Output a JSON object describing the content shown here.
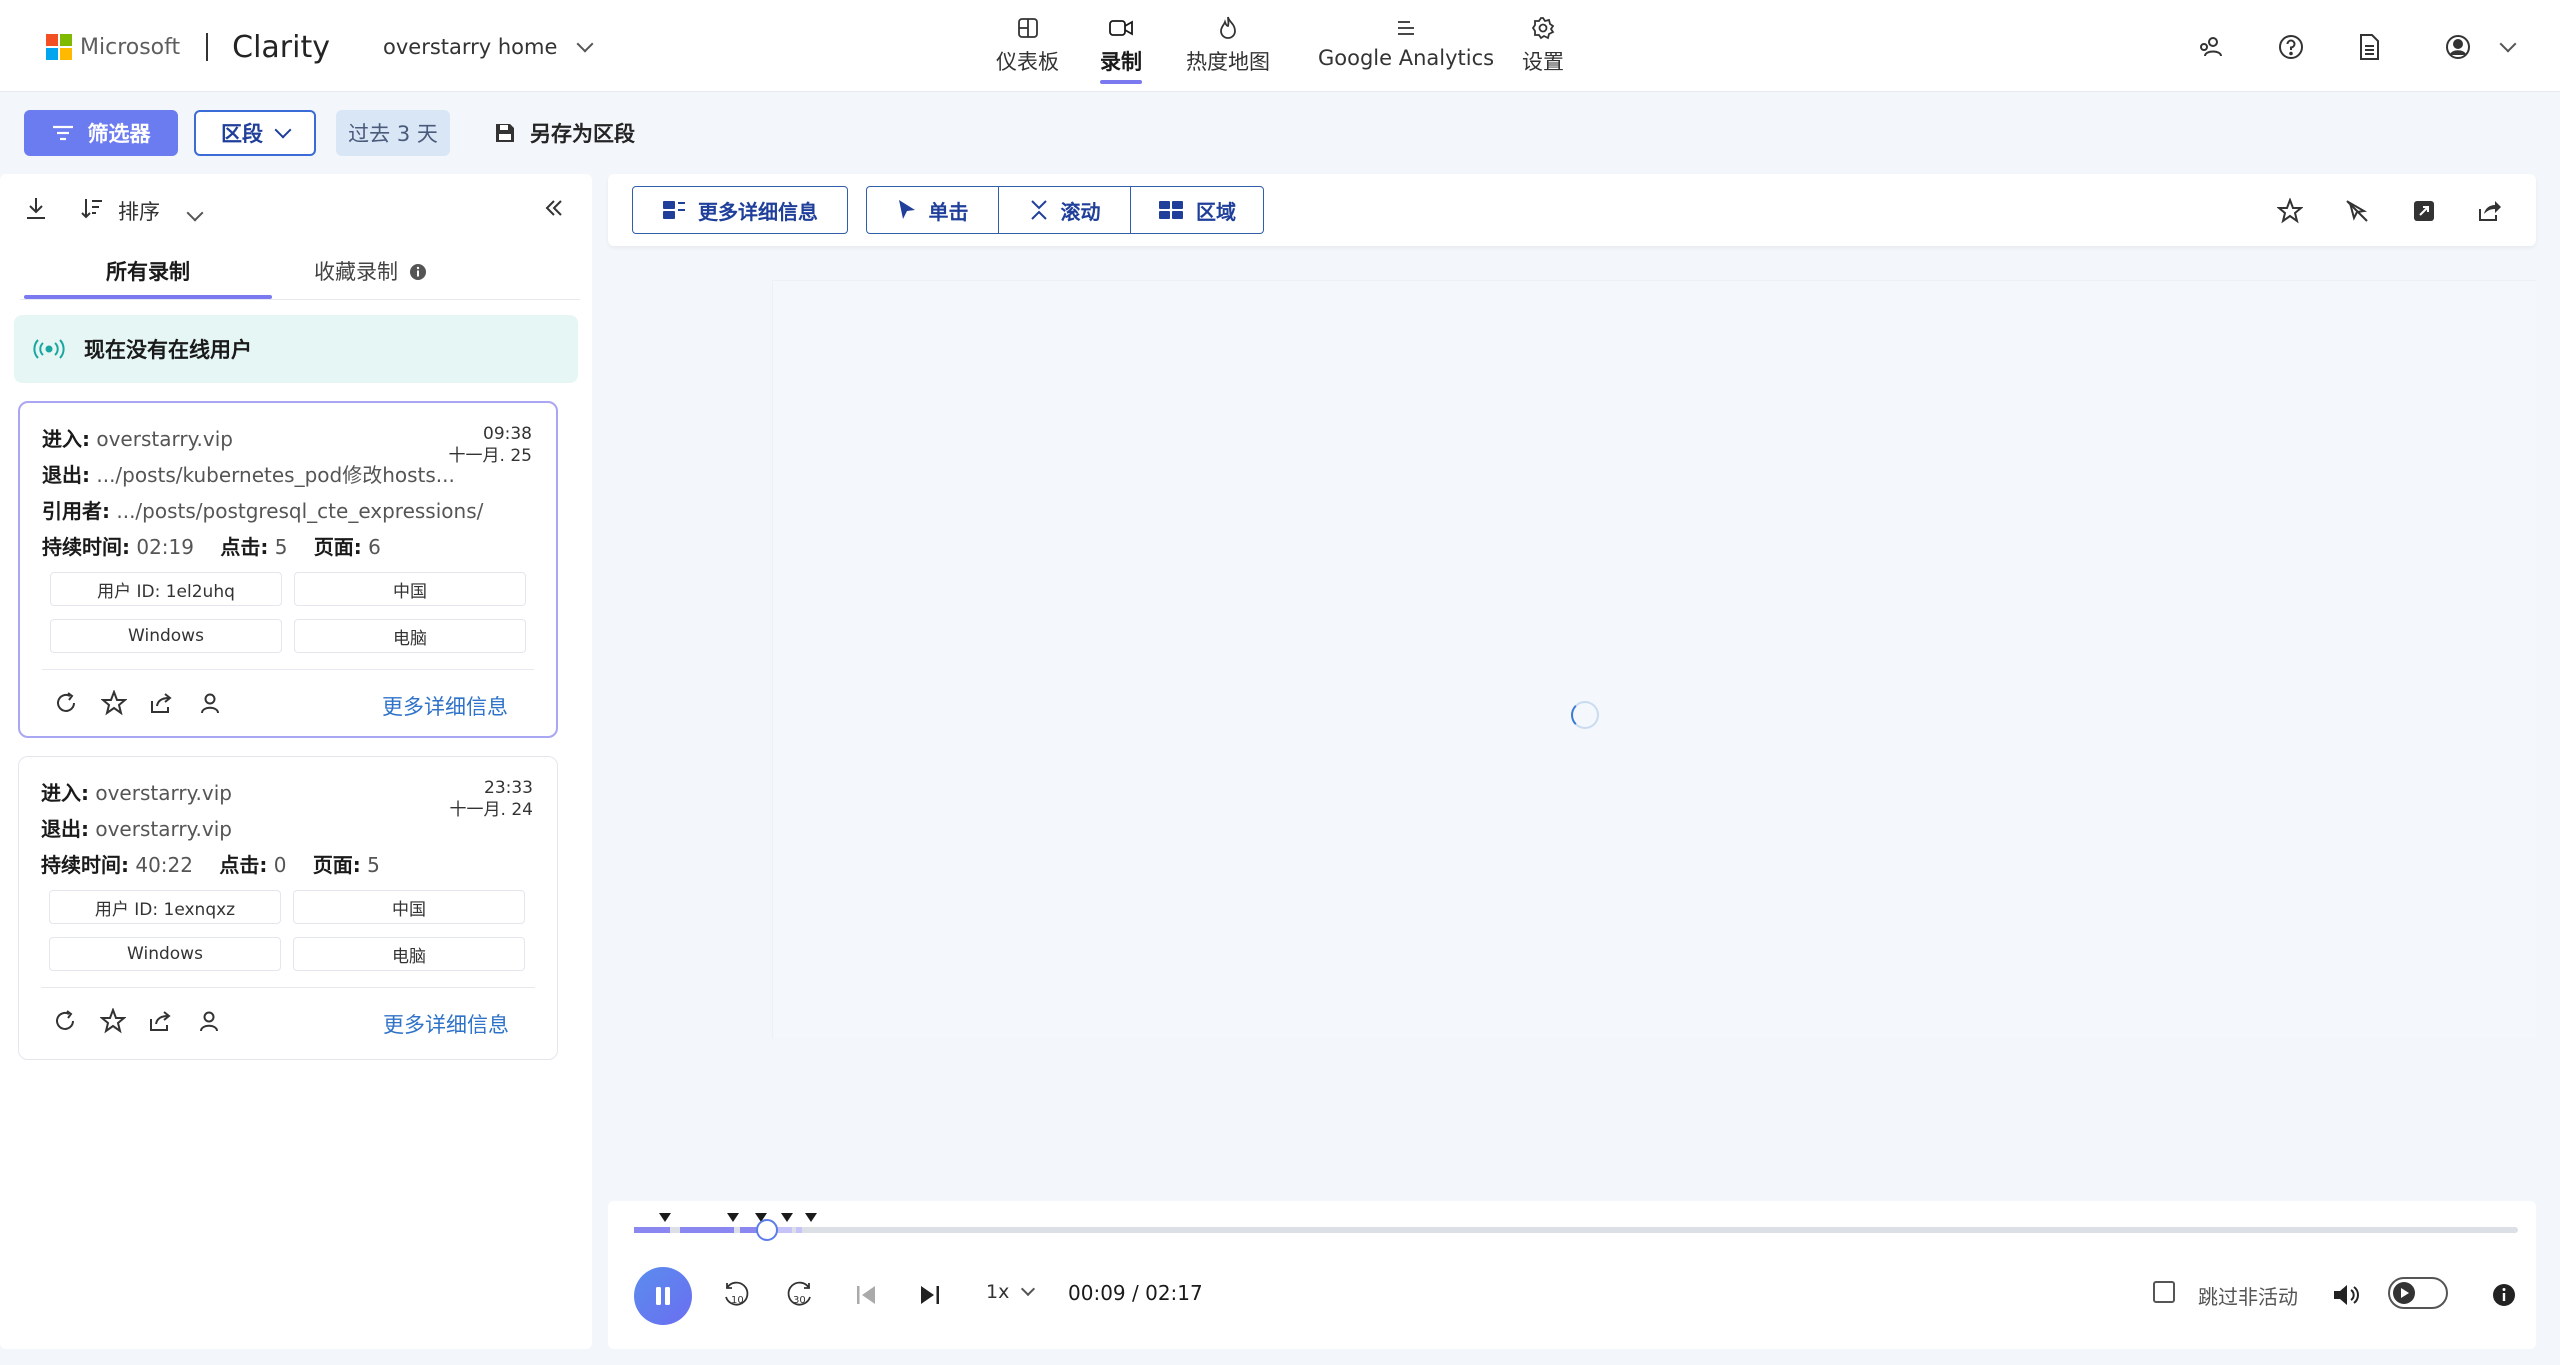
{
  "header": {
    "ms_name": "Microsoft",
    "app_name": "Clarity",
    "project": "overstarry home",
    "nav": [
      {
        "label": "仪表板"
      },
      {
        "label": "录制"
      },
      {
        "label": "热度地图"
      },
      {
        "label": "Google Analytics"
      },
      {
        "label": "设置"
      }
    ],
    "active_nav": "录制",
    "accent_color": "#7b79ef"
  },
  "toolbar": {
    "filter_label": "筛选器",
    "segment_label": "区段",
    "date_label": "过去 3 天",
    "save_segment_label": "另存为区段"
  },
  "sidebar": {
    "sort_label": "排序",
    "tabs": [
      {
        "label": "所有录制"
      },
      {
        "label": "收藏录制"
      }
    ],
    "live_text": "现在没有在线用户",
    "more_link": "更多详细信息",
    "labels": {
      "entry": "进入:",
      "exit": "退出:",
      "referrer": "引用者:",
      "duration": "持续时间:",
      "clicks": "点击:",
      "pages": "页面:"
    },
    "sessions": [
      {
        "entry": "overstarry.vip",
        "exit": ".../posts/kubernetes_pod修改hosts...",
        "referrer": ".../posts/postgresql_cte_expressions/",
        "duration": "02:19",
        "clicks": "5",
        "pages": "6",
        "time": "09:38",
        "date": "十一月. 25",
        "user_id": "用户 ID: 1el2uhq",
        "country": "中国",
        "os": "Windows",
        "device": "电脑"
      },
      {
        "entry": "overstarry.vip",
        "exit": "overstarry.vip",
        "duration": "40:22",
        "clicks": "0",
        "pages": "5",
        "time": "23:33",
        "date": "十一月. 24",
        "user_id": "用户 ID: 1exnqxz",
        "country": "中国",
        "os": "Windows",
        "device": "电脑"
      }
    ]
  },
  "player_toolbar": {
    "details_label": "更多详细信息",
    "click_label": "单击",
    "scroll_label": "滚动",
    "area_label": "区域"
  },
  "player": {
    "current_time": "00:09",
    "total_time": "02:17",
    "time_display": "00:09 / 02:17",
    "progress_fraction": 0.066,
    "speed": "1x",
    "skip_inactive_label": "跳过非活动",
    "skip_inactive_checked": false,
    "rewind_seconds": "10",
    "forward_seconds": "30"
  }
}
